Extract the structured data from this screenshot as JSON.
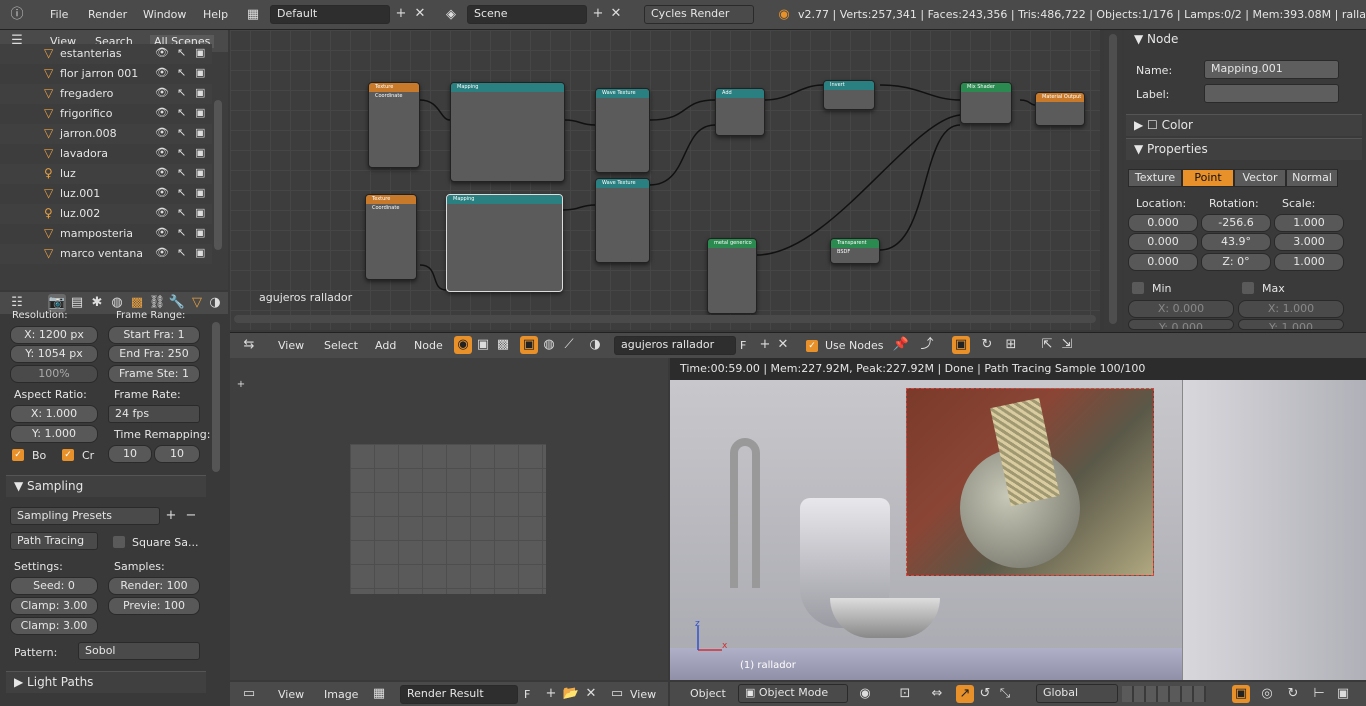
{
  "header": {
    "menu": [
      "File",
      "Render",
      "Window",
      "Help"
    ],
    "layout": "Default",
    "scene": "Scene",
    "engine": "Cycles Render",
    "stats": "v2.77 | Verts:257,341 | Faces:243,356 | Tris:486,722 | Objects:1/176 | Lamps:0/2 | Mem:393.08M | rallador"
  },
  "outliner": {
    "tabs": [
      "View",
      "Search",
      "All Scenes"
    ],
    "items": [
      "estanterias",
      "flor jarron 001",
      "fregadero",
      "frigorifico",
      "jarron.008",
      "lavadora",
      "luz",
      "luz.001",
      "luz.002",
      "mamposteria",
      "marco ventana"
    ]
  },
  "render_props": {
    "resolution_label": "Resolution:",
    "res_x": "X:  1200 px",
    "res_y": "Y:  1054 px",
    "percent": "100%",
    "frame_range_label": "Frame Range:",
    "start": "Start Fra:  1",
    "end": "End Fra: 250",
    "step": "Frame Ste: 1",
    "aspect_label": "Aspect Ratio:",
    "asp_x": "X:    1.000",
    "asp_y": "Y:    1.000",
    "frame_rate_label": "Frame Rate:",
    "fps": "24 fps",
    "time_remap_label": "Time Remapping:",
    "remap_old": "10",
    "remap_new": "10",
    "bo": "Bo",
    "cr": "Cr",
    "sampling": "Sampling",
    "presets": "Sampling Presets",
    "path_tracing": "Path Tracing",
    "square": "Square Sa...",
    "settings_label": "Settings:",
    "samples_label": "Samples:",
    "seed": "Seed:   0",
    "clamp1": "Clamp: 3.00",
    "clamp2": "Clamp: 3.00",
    "render": "Render: 100",
    "preview": "Previe:  100",
    "pattern_label": "Pattern:",
    "pattern": "Sobol",
    "light_paths": "Light Paths"
  },
  "node_editor": {
    "label": "agujeros rallador",
    "bar": [
      "View",
      "Select",
      "Add",
      "Node"
    ],
    "material": "agujeros rallador",
    "use_nodes": "Use Nodes",
    "nodes": [
      "Texture Coordinate",
      "Mapping",
      "Wave Texture",
      "Add",
      "Invert",
      "Mix Shader",
      "Material Output",
      "Texture Coordinate",
      "Mapping",
      "Wave Texture",
      "metal generico",
      "Transparent BSDF"
    ]
  },
  "node_panel": {
    "node": "Node",
    "name_label": "Name:",
    "name": "Mapping.001",
    "label_label": "Label:",
    "color": "Color",
    "properties": "Properties",
    "tabs": [
      "Texture",
      "Point",
      "Vector",
      "Normal"
    ],
    "location": "Location:",
    "rotation": "Rotation:",
    "scale": "Scale:",
    "loc": [
      "0.000",
      "0.000",
      "0.000"
    ],
    "rot": [
      "-256.6",
      "43.9°",
      "Z:    0°"
    ],
    "scl": [
      "1.000",
      "3.000",
      "1.000"
    ],
    "min": "Min",
    "max": "Max",
    "min_x": "X:    0.000",
    "max_x": "X:    1.000",
    "min_y": "Y:    0.000",
    "max_y": "Y:    1.000"
  },
  "image_editor": {
    "bar": [
      "View",
      "Image"
    ],
    "image": "Render Result",
    "view": "View"
  },
  "viewport": {
    "status": "Time:00:59.00 | Mem:227.92M, Peak:227.92M | Done | Path Tracing Sample 100/100",
    "object_label": "(1) rallador",
    "bar": [
      "Object"
    ],
    "mode": "Object Mode",
    "orientation": "Global"
  }
}
